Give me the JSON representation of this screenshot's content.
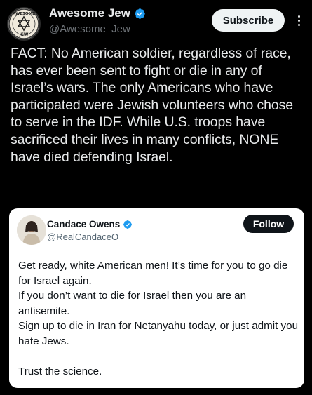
{
  "post": {
    "author": {
      "display_name": "Awesome Jew",
      "handle": "@Awesome_Jew_",
      "avatar_text_top": "AWESOME",
      "avatar_text_bottom": "JEW"
    },
    "subscribe_label": "Subscribe",
    "text": "FACT: No American soldier, regardless of race, has ever been sent to fight or die in any of Israel’s wars. The only Americans who have participated were Jewish volunteers who chose to serve in the IDF. While U.S. troops have sacrificed their lives in many conflicts, NONE have died defending Israel."
  },
  "quoted_post": {
    "author": {
      "display_name": "Candace Owens",
      "handle": "@RealCandaceO"
    },
    "follow_label": "Follow",
    "lines": [
      "Get ready, white American men! It’s time for you to go die for Israel again.",
      "If you don’t want to die for Israel then you are an antisemite.",
      "Sign up to die in Iran for Netanyahu today, or just admit you hate Jews.",
      "Trust the science."
    ]
  },
  "colors": {
    "background": "#000000",
    "verified_blue": "#1d9bf0",
    "text_primary": "#e7e9ea",
    "text_secondary": "#71767b"
  },
  "icons": {
    "verified": "verified-badge-icon",
    "more": "more-options-icon"
  }
}
